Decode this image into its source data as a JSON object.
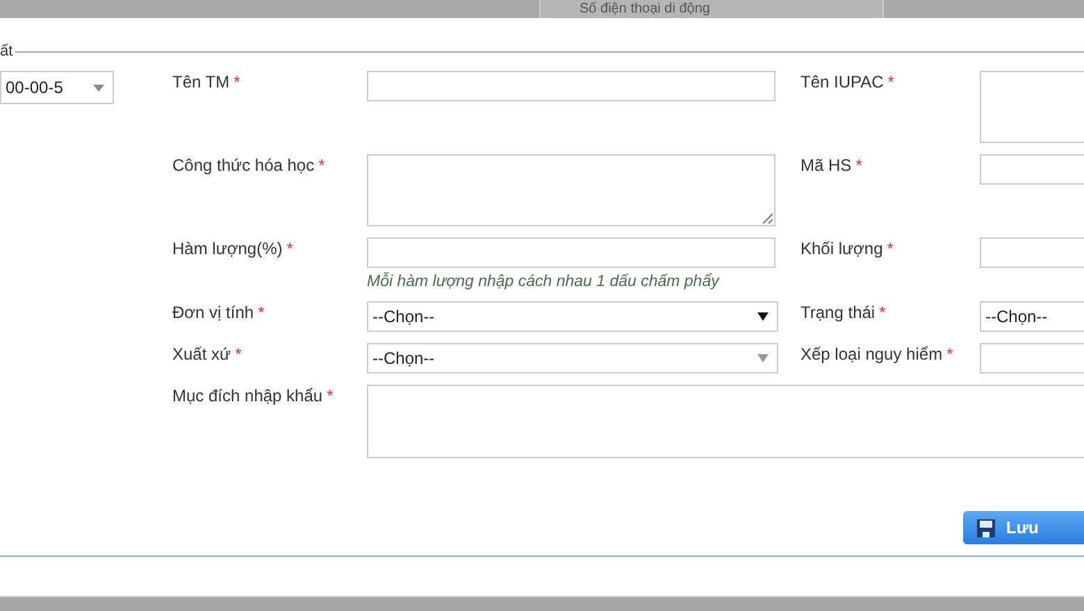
{
  "top_bar": {
    "text": "Số điện thoại di động"
  },
  "fieldset": {
    "legend": "ất"
  },
  "left_select": {
    "value": "00-00-5"
  },
  "rows": [
    {
      "left": {
        "label": "Tên TM",
        "required_mark": "*",
        "kind": "input"
      },
      "right": {
        "label": "Tên IUPAC",
        "required_mark": "*",
        "kind": "textarea"
      }
    },
    {
      "left": {
        "label": "Công thức hóa học",
        "required_mark": "*",
        "kind": "textarea"
      },
      "right": {
        "label": "Mã HS",
        "required_mark": "*",
        "kind": "input"
      }
    },
    {
      "left": {
        "label": "Hàm lượng(%)",
        "required_mark": "*",
        "kind": "input",
        "hint": "Mỗi hàm lượng nhập cách nhau 1 dấu chấm phẩy"
      },
      "right": {
        "label": "Khối lượng",
        "required_mark": "*",
        "kind": "input"
      }
    },
    {
      "left": {
        "label": "Đơn vị tính",
        "required_mark": "*",
        "kind": "select",
        "value": "--Chọn--",
        "caret_dark": true
      },
      "right": {
        "label": "Trạng thái",
        "required_mark": "*",
        "kind": "select",
        "value": "--Chọn--"
      }
    },
    {
      "left": {
        "label": "Xuất xứ",
        "required_mark": "*",
        "kind": "select",
        "value": "--Chọn--",
        "caret_dark": false
      },
      "right": {
        "label": "Xếp loại nguy hiểm",
        "required_mark": "*",
        "kind": "input"
      }
    },
    {
      "left": {
        "label": "Mục đích nhập khẩu",
        "required_mark": "*",
        "kind": "wide-textarea"
      }
    }
  ],
  "save_button": {
    "label": "Lưu"
  }
}
